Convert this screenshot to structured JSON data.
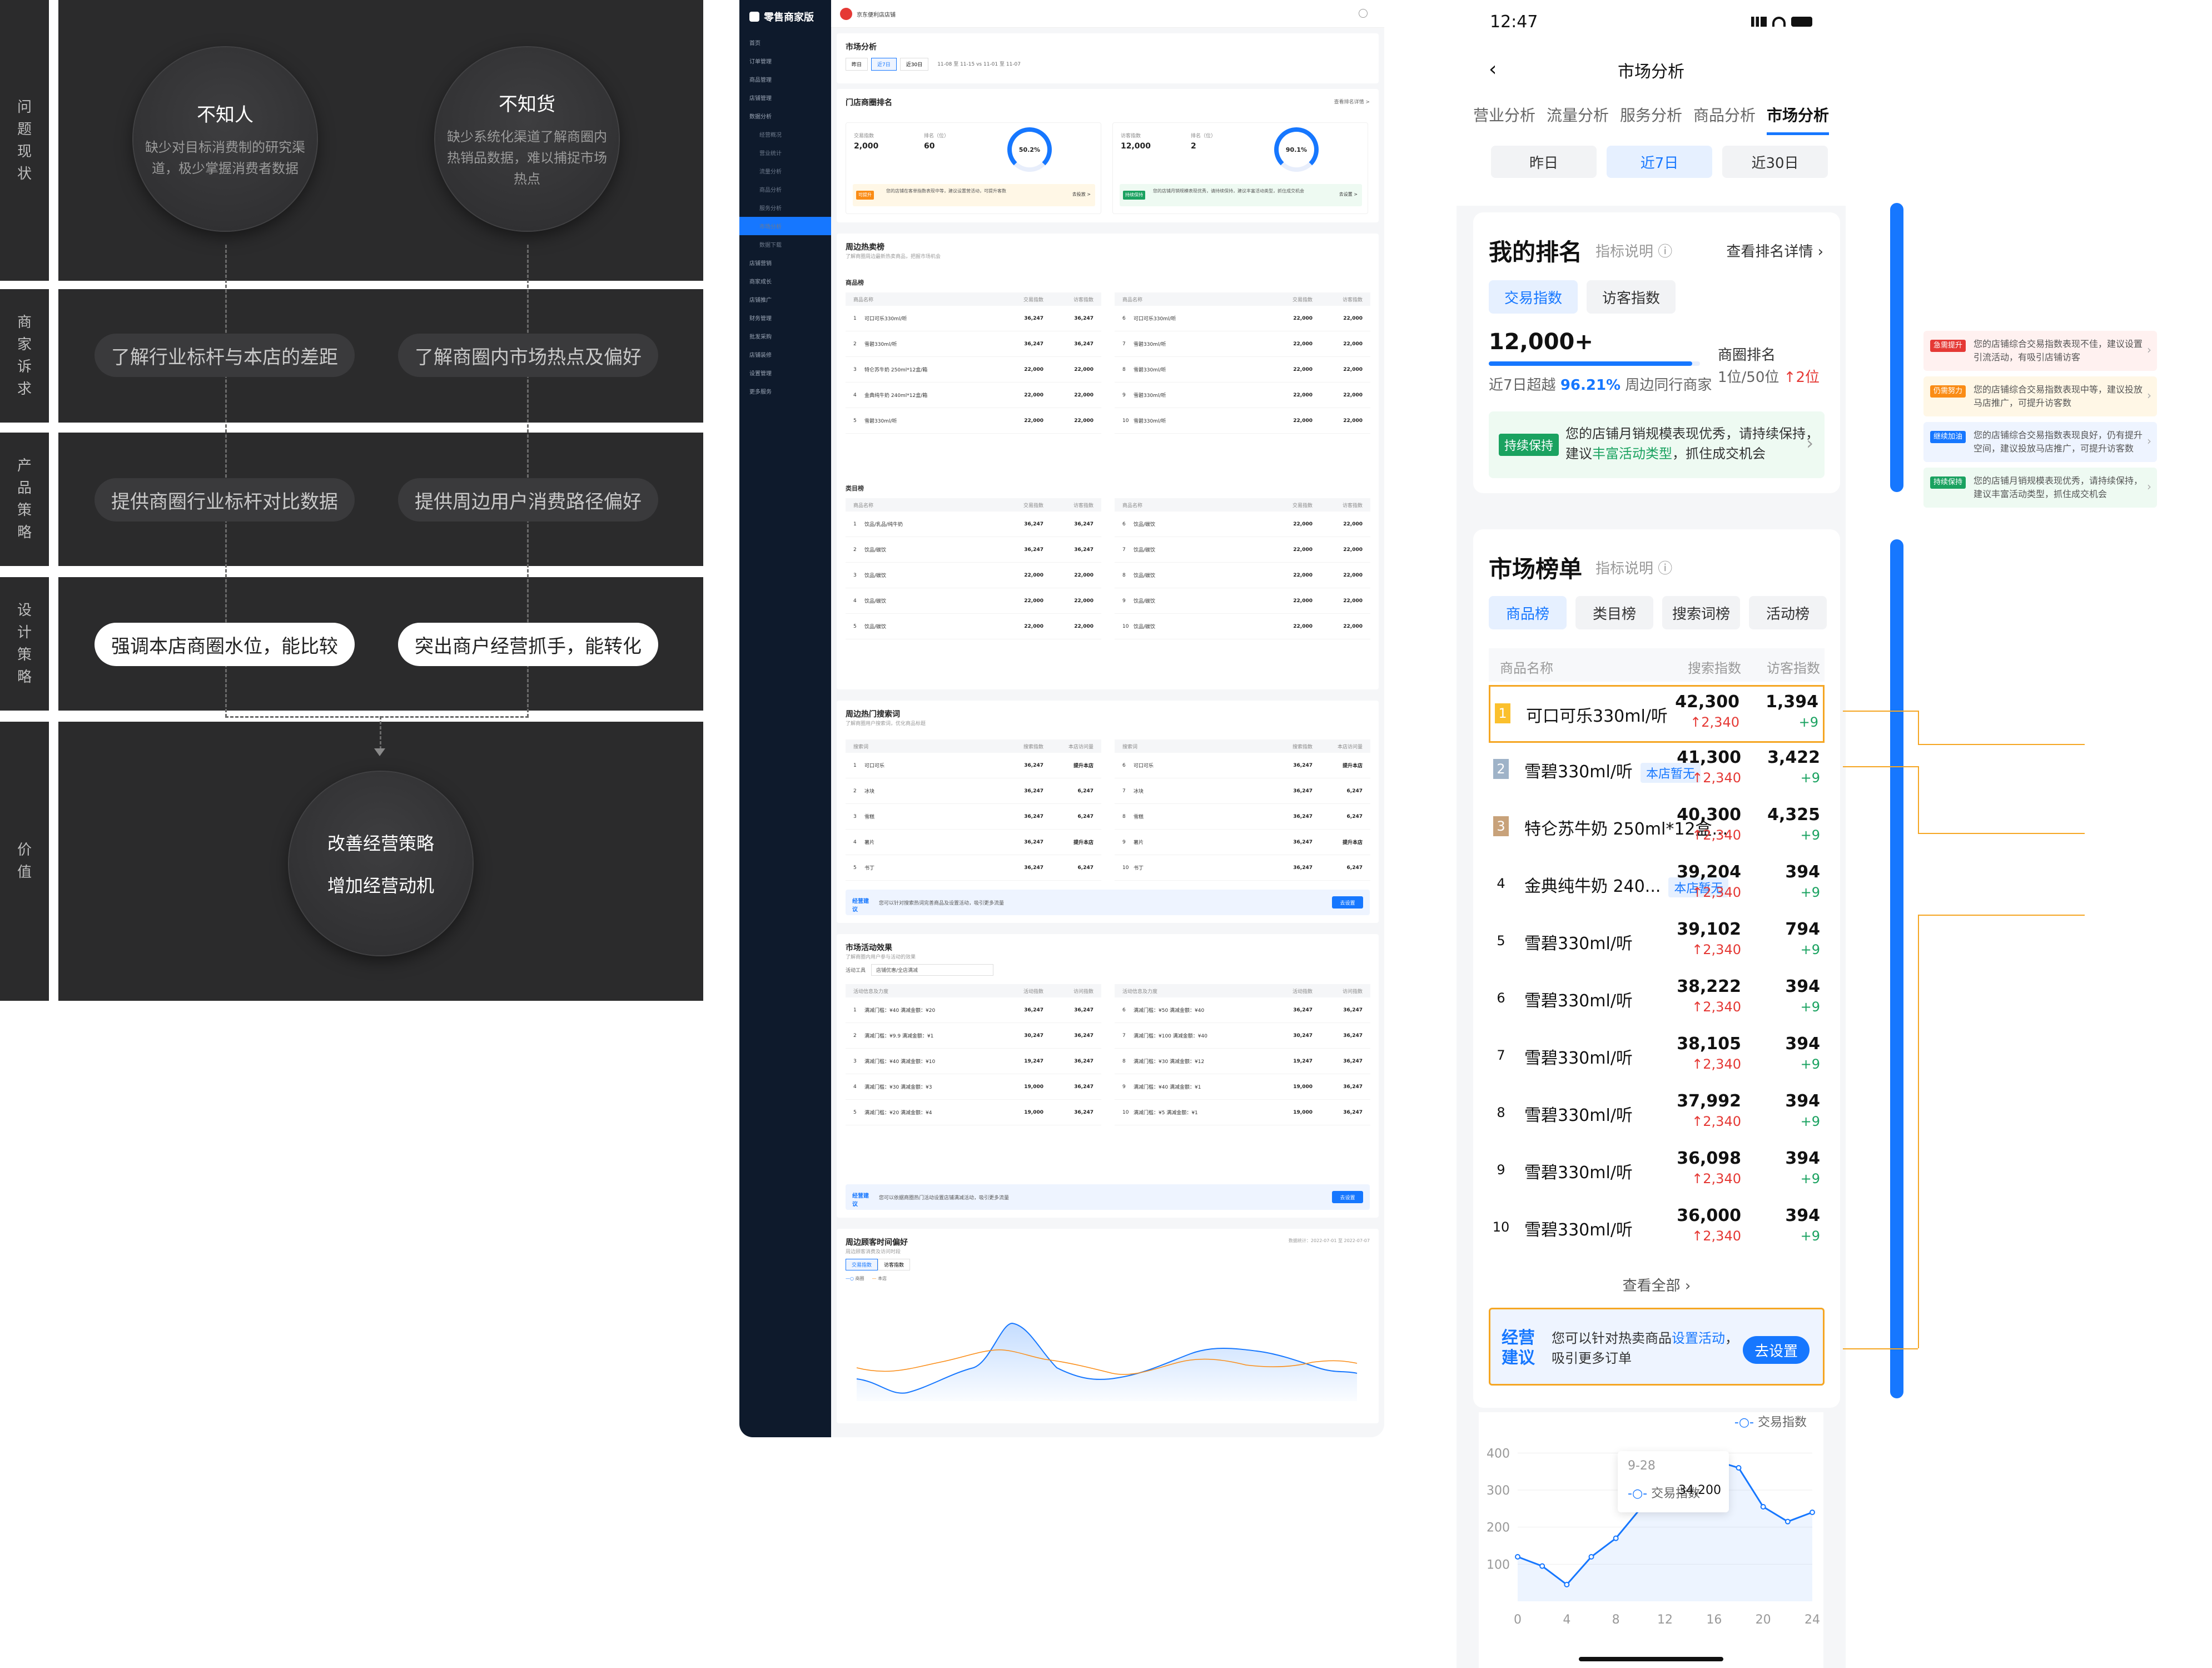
{
  "diagram": {
    "rows": [
      {
        "label": "问题现状"
      },
      {
        "label": "商家诉求"
      },
      {
        "label": "产品策略"
      },
      {
        "label": "设计策略"
      },
      {
        "label": "价值"
      }
    ],
    "problems": [
      {
        "title": "不知人",
        "desc": "缺少对目标消费制的研究渠道，极少掌握消费者数据"
      },
      {
        "title": "不知货",
        "desc": "缺少系统化渠道了解商圈内热销品数据，难以捕捉市场热点"
      }
    ],
    "demands": [
      "了解行业标杆与本店的差距",
      "了解商圈内市场热点及偏好"
    ],
    "product": [
      "提供商圈行业标杆对比数据",
      "提供周边用户消费路径偏好"
    ],
    "design": [
      "强调本店商圈水位，能比较",
      "突出商户经营抓手，能转化"
    ],
    "value": [
      "改善经营策略",
      "增加经营动机"
    ]
  },
  "desktop": {
    "brand": "零售商家版",
    "shop": "京东便利店店铺",
    "sidebar": [
      "首页",
      "订单管理",
      "商品管理",
      "店铺管理",
      "数据分析",
      "经营概况",
      "营业统计",
      "流量分析",
      "商品分析",
      "服务分析",
      "市场分析",
      "数据下载",
      "店铺营销",
      "商家成长",
      "店铺推广",
      "财务管理",
      "批发采购",
      "店铺装修",
      "设置管理",
      "更多服务"
    ],
    "page_title": "市场分析",
    "range_tabs": [
      "昨日",
      "近7日",
      "近30日"
    ],
    "date_range": "11-08 至 11-15 vs 11-01 至 11-07",
    "rank_card": {
      "title": "门店商圈排名",
      "link": "查看排名详情 >"
    },
    "rank_blocks": [
      {
        "label1": "交易指数",
        "value1": "2,000",
        "label2": "排名（位）",
        "value2": "60",
        "pct": "50.2%",
        "tip": "您的店铺在客单指数表现中等，建议设置营活动，可提升客数",
        "tip_btn": "去投放 >",
        "tip_tag": "可提升"
      },
      {
        "label1": "访客指数",
        "value1": "12,000",
        "label2": "排名（位）",
        "value2": "2",
        "pct": "90.1%",
        "tip": "您的店铺月销规模表现优秀，请持续保持，建议丰富活动类型，抓住成交机会",
        "tip_btn": "去设置 >",
        "tip_tag": "持续保持"
      }
    ],
    "hot_sale": {
      "title": "周边热卖榜",
      "sub": "了解商圈周边最新热卖商品，把握市场机会",
      "section1": "商品榜",
      "section2": "类目榜"
    },
    "col_headers": [
      "商品名称",
      "交易指数",
      "访客指数"
    ],
    "goods_left": [
      {
        "n": "1",
        "name": "可口可乐330ml/听",
        "v1": "36,247",
        "v2": "36,247"
      },
      {
        "n": "2",
        "name": "雪碧330ml/听",
        "v1": "36,247",
        "v2": "36,247"
      },
      {
        "n": "3",
        "name": "特仑苏牛奶 250ml*12盒/箱",
        "v1": "22,000",
        "v2": "22,000"
      },
      {
        "n": "4",
        "name": "金典纯牛奶 240ml*12盒/箱",
        "v1": "22,000",
        "v2": "22,000"
      },
      {
        "n": "5",
        "name": "雪碧330ml/听",
        "v1": "22,000",
        "v2": "22,000"
      }
    ],
    "goods_right": [
      {
        "n": "6",
        "name": "可口可乐330ml/听",
        "v1": "22,000",
        "v2": "22,000"
      },
      {
        "n": "7",
        "name": "雪碧330ml/听",
        "v1": "22,000",
        "v2": "22,000"
      },
      {
        "n": "8",
        "name": "雪碧330ml/听",
        "v1": "22,000",
        "v2": "22,000"
      },
      {
        "n": "9",
        "name": "雪碧330ml/听",
        "v1": "22,000",
        "v2": "22,000"
      },
      {
        "n": "10",
        "name": "雪碧330ml/听",
        "v1": "22,000",
        "v2": "22,000"
      }
    ],
    "cats_left": [
      {
        "n": "1",
        "name": "饮品/乳品/纯牛奶",
        "v1": "36,247",
        "v2": "36,247"
      },
      {
        "n": "2",
        "name": "饮品/碳饮",
        "v1": "36,247",
        "v2": "36,247"
      },
      {
        "n": "3",
        "name": "饮品/碳饮",
        "v1": "22,000",
        "v2": "22,000"
      },
      {
        "n": "4",
        "name": "饮品/碳饮",
        "v1": "22,000",
        "v2": "22,000"
      },
      {
        "n": "5",
        "name": "饮品/碳饮",
        "v1": "22,000",
        "v2": "22,000"
      }
    ],
    "cats_right": [
      {
        "n": "6",
        "name": "饮品/碳饮",
        "v1": "22,000",
        "v2": "22,000"
      },
      {
        "n": "7",
        "name": "饮品/碳饮",
        "v1": "22,000",
        "v2": "22,000"
      },
      {
        "n": "8",
        "name": "饮品/碳饮",
        "v1": "22,000",
        "v2": "22,000"
      },
      {
        "n": "9",
        "name": "饮品/碳饮",
        "v1": "22,000",
        "v2": "22,000"
      },
      {
        "n": "10",
        "name": "饮品/碳饮",
        "v1": "22,000",
        "v2": "22,000"
      }
    ],
    "search": {
      "title": "周边热门搜索词",
      "sub": "了解商圈用户搜索词，优化商品标题",
      "headers": [
        "搜索词",
        "搜索指数",
        "本店访问量"
      ]
    },
    "search_left": [
      {
        "n": "1",
        "name": "可口可乐",
        "v1": "36,247",
        "v2": "提升本店"
      },
      {
        "n": "2",
        "name": "冰块",
        "v1": "36,247",
        "v2": "6,247"
      },
      {
        "n": "3",
        "name": "雪糕",
        "v1": "36,247",
        "v2": "6,247"
      },
      {
        "n": "4",
        "name": "薯片",
        "v1": "36,247",
        "v2": "提升本店"
      },
      {
        "n": "5",
        "name": "书丁",
        "v1": "36,247",
        "v2": "6,247"
      }
    ],
    "search_right": [
      {
        "n": "6",
        "name": "可口可乐",
        "v1": "36,247",
        "v2": "提升本店"
      },
      {
        "n": "7",
        "name": "冰块",
        "v1": "36,247",
        "v2": "6,247"
      },
      {
        "n": "8",
        "name": "雪糕",
        "v1": "36,247",
        "v2": "6,247"
      },
      {
        "n": "9",
        "name": "薯片",
        "v1": "36,247",
        "v2": "提升本店"
      },
      {
        "n": "10",
        "name": "书丁",
        "v1": "36,247",
        "v2": "6,247"
      }
    ],
    "advice1": {
      "tag": "经营建议",
      "text": "您可以针对搜索热词完善商品及设置活动，吸引更多流量",
      "btn": "去设置"
    },
    "activity": {
      "title": "市场活动效果",
      "sub": "了解商圈内用户参与活动的效果",
      "tool_label": "活动工具",
      "tool_value": "店铺优惠/全店满减",
      "headers": [
        "活动信息及力度",
        "活动指数",
        "访问指数"
      ]
    },
    "act_left": [
      {
        "n": "1",
        "name": "满减门槛：¥40  满减金额：¥20",
        "v1": "36,247",
        "v2": "36,247"
      },
      {
        "n": "2",
        "name": "满减门槛：¥9.9  满减金额：¥1",
        "v1": "30,247",
        "v2": "36,247"
      },
      {
        "n": "3",
        "name": "满减门槛：¥40  满减金额：¥10",
        "v1": "19,247",
        "v2": "36,247"
      },
      {
        "n": "4",
        "name": "满减门槛：¥30  满减金额：¥3",
        "v1": "19,000",
        "v2": "36,247"
      },
      {
        "n": "5",
        "name": "满减门槛：¥20  满减金额：¥4",
        "v1": "19,000",
        "v2": "36,247"
      }
    ],
    "act_right": [
      {
        "n": "6",
        "name": "满减门槛：¥50  满减金额：¥40",
        "v1": "36,247",
        "v2": "36,247"
      },
      {
        "n": "7",
        "name": "满减门槛：¥100  满减金额：¥40",
        "v1": "30,247",
        "v2": "36,247"
      },
      {
        "n": "8",
        "name": "满减门槛：¥30  满减金额：¥12",
        "v1": "19,247",
        "v2": "36,247"
      },
      {
        "n": "9",
        "name": "满减门槛：¥40  满减金额：¥1",
        "v1": "19,000",
        "v2": "36,247"
      },
      {
        "n": "10",
        "name": "满减门槛：¥5  满减金额：¥1",
        "v1": "19,000",
        "v2": "36,247"
      }
    ],
    "advice2": {
      "tag": "经营建议",
      "text": "您可以依据商圈热门活动设置店铺满减活动，吸引更多流量",
      "btn": "去设置"
    },
    "time_pref": {
      "title": "周边顾客时间偏好",
      "sub": "周边顾客消费及访问时段",
      "tabs": [
        "交易指数",
        "访客指数"
      ],
      "legend": [
        "商圈",
        "本店"
      ],
      "update": "数据统计：2022-07-01 至 2022-07-07"
    }
  },
  "mobile": {
    "time": "12:47",
    "title": "市场分析",
    "tabs": [
      "营业分析",
      "流量分析",
      "服务分析",
      "商品分析",
      "市场分析"
    ],
    "range": [
      "昨日",
      "近7日",
      "近30日"
    ],
    "my_rank": {
      "title": "我的排名",
      "hint": "指标说明",
      "link": "查看排名详情",
      "chips": [
        "交易指数",
        "访客指数"
      ],
      "value": "12,000+",
      "desc_prefix": "近7日超越",
      "desc_pct": "96.21%",
      "desc_suffix": "周边同行商家",
      "rank_label": "商圈排名",
      "rank_value": "1位/50位",
      "rank_delta": "2位",
      "progress": 0.9621,
      "tip_tag": "持续保持",
      "tip_line1": "您的店铺月销规模表现优秀，请持续保持，",
      "tip_line2_a": "建议",
      "tip_line2_link": "丰富活动类型",
      "tip_line2_b": "，抓住成交机会"
    },
    "market": {
      "title": "市场榜单",
      "hint": "指标说明",
      "chips": [
        "商品榜",
        "类目榜",
        "搜索词榜",
        "活动榜"
      ],
      "headers": [
        "商品名称",
        "搜索指数",
        "访客指数"
      ],
      "rows": [
        {
          "rank": "1",
          "name": "可口可乐330ml/听",
          "tag": "",
          "v1": "42,300",
          "d1": "2,340",
          "v2": "1,394",
          "d2": "9"
        },
        {
          "rank": "2",
          "name": "雪碧330ml/听",
          "tag": "本店暂无",
          "v1": "41,300",
          "d1": "2,340",
          "v2": "3,422",
          "d2": "9"
        },
        {
          "rank": "3",
          "name": "特仑苏牛奶 250ml*12盒...",
          "tag": "",
          "v1": "40,300",
          "d1": "2,340",
          "v2": "4,325",
          "d2": "9"
        },
        {
          "rank": "4",
          "name": "金典纯牛奶 240...",
          "tag": "本店暂无",
          "v1": "39,204",
          "d1": "2,340",
          "v2": "394",
          "d2": "9"
        },
        {
          "rank": "5",
          "name": "雪碧330ml/听",
          "tag": "",
          "v1": "39,102",
          "d1": "2,340",
          "v2": "794",
          "d2": "9"
        },
        {
          "rank": "6",
          "name": "雪碧330ml/听",
          "tag": "",
          "v1": "38,222",
          "d1": "2,340",
          "v2": "394",
          "d2": "9"
        },
        {
          "rank": "7",
          "name": "雪碧330ml/听",
          "tag": "",
          "v1": "38,105",
          "d1": "2,340",
          "v2": "394",
          "d2": "9"
        },
        {
          "rank": "8",
          "name": "雪碧330ml/听",
          "tag": "",
          "v1": "37,992",
          "d1": "2,340",
          "v2": "394",
          "d2": "9"
        },
        {
          "rank": "9",
          "name": "雪碧330ml/听",
          "tag": "",
          "v1": "36,098",
          "d1": "2,340",
          "v2": "394",
          "d2": "9"
        },
        {
          "rank": "10",
          "name": "雪碧330ml/听",
          "tag": "",
          "v1": "36,000",
          "d1": "2,340",
          "v2": "394",
          "d2": "9"
        }
      ],
      "see_all": "查看全部",
      "advice_tag": "经营建议",
      "advice_text_a": "您可以针对热卖商品",
      "advice_link": "设置活动",
      "advice_text_b": "，吸引更多订单",
      "advice_btn": "去设置"
    },
    "chart_legend": "交易指数",
    "tooltip": {
      "date": "9-28",
      "label": "交易指数",
      "value": "34,200"
    }
  },
  "annotations": [
    {
      "tag": "急需提升",
      "color": "#e53935",
      "bg": "#fff1f0",
      "text": "您的店铺综合交易指数表现不佳，建议设置引流活动，有吸引店铺访客"
    },
    {
      "tag": "仍需努力",
      "color": "#fa8c16",
      "bg": "#fff7e6",
      "text": "您的店铺综合交易指数表现中等，建议投放马店推广，可提升访客数"
    },
    {
      "tag": "继续加油",
      "color": "#1677ff",
      "bg": "#eef4ff",
      "text": "您的店铺综合交易指数表现良好，仍有提升空间，建议投放马店推广，可提升访客数"
    },
    {
      "tag": "持续保持",
      "color": "#1aa260",
      "bg": "#eefaf2",
      "text": "您的店铺月销规模表现优秀，请持续保持，建议丰富活动类型，抓住成交机会"
    }
  ],
  "chart_data": {
    "type": "line",
    "x": [
      0,
      2,
      4,
      6,
      8,
      10,
      12,
      14,
      16,
      18,
      20,
      22,
      24
    ],
    "series": [
      {
        "name": "交易指数",
        "values": [
          120,
          95,
          45,
          120,
          170,
          250,
          310,
          350,
          380,
          360,
          255,
          215,
          240
        ]
      }
    ],
    "xticks": [
      "0",
      "4",
      "8",
      "12",
      "16",
      "20",
      "24"
    ],
    "yticks": [
      "100",
      "200",
      "300",
      "400"
    ],
    "ylim": [
      0,
      420
    ]
  }
}
